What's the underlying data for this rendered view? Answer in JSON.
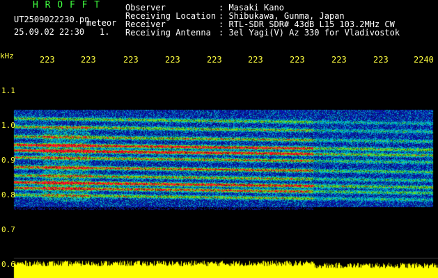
{
  "header": {
    "brand": "H R O F F T",
    "filename": "UT2509022230.pn",
    "tag": "meteor",
    "datetime": "25.09.02 22:30",
    "index": "1."
  },
  "info": [
    {
      "label": "Observer",
      "value": ": Masaki Kano"
    },
    {
      "label": "Receiving Location",
      "value": ": Shibukawa, Gunma, Japan"
    },
    {
      "label": "Receiver",
      "value": ": RTL-SDR SDR# 43dB L15 103.2MHz CW"
    },
    {
      "label": "Receiving Antenna",
      "value": ": 3el Yagi(V) Az 330 for Vladivostok"
    }
  ],
  "axis": {
    "freq_unit": "kHz",
    "freq_ticks": [
      "1.1",
      "1.0",
      "0.9",
      "0.8",
      "0.7",
      "0.6"
    ],
    "time_ticks": [
      "223",
      "223",
      "223",
      "223",
      "223",
      "223",
      "223",
      "223",
      "223",
      "2240"
    ]
  },
  "colors": {
    "background": "#000000",
    "label_yellow": "#ffff3f",
    "brand_green": "#3fff3f",
    "text_white": "#ffffff",
    "signal_low": "#1010a0",
    "signal_mid": "#00c8c8",
    "signal_high": "#ff2020",
    "power_bar": "#ffff00"
  }
}
